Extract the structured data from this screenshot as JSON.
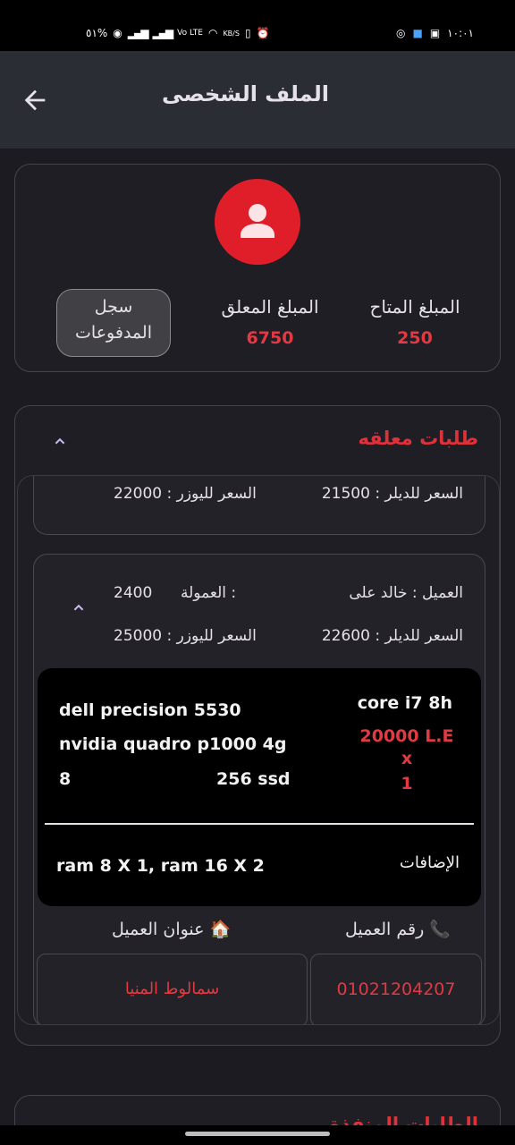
{
  "status_bar": {
    "time": "١٠:٠١",
    "battery": "٥١%",
    "speed": "KB/S",
    "volte": "Vo LTE"
  },
  "app_bar": {
    "title": "الملف الشخصى",
    "back_icon": "arrow-left-icon"
  },
  "profile": {
    "avatar_icon": "person-icon",
    "available_label": "المبلغ المتاح",
    "available_value": "250",
    "pending_label": "المبلغ المعلق",
    "pending_value": "6750",
    "payments_button_line1": "سجل",
    "payments_button_line2": "المدفوعات"
  },
  "pending_orders": {
    "title": "طلبات معلقه",
    "chevron_icon": "chevron-up-icon",
    "orders": [
      {
        "dealer_price": "السعر للديلر : 21500",
        "user_price": "السعر لليوزر : 22000"
      },
      {
        "customer": "العميل : خالد على",
        "commission_label": "العمولة :",
        "commission_value": "2400",
        "dealer_price": "السعر للديلر : 22600",
        "user_price": "السعر لليوزر : 25000",
        "details": {
          "model": "dell precision 5530",
          "gpu": "nvidia quadro p1000 4g",
          "ram": "8",
          "storage": "256 ssd",
          "cpu": "core i7 8h",
          "price": "20000 L.E",
          "x": "x",
          "qty": "1",
          "additions_label": "الإضافات",
          "additions_value": "ram 8 X 1, ram 16 X 2"
        },
        "phone_label": "رقم العميل",
        "phone_icon": "phone-icon",
        "address_label": "عنوان العميل",
        "address_icon": "house-icon",
        "phone_value": "01021204207",
        "address_value": "سمالوط المنيا"
      }
    ]
  },
  "next_section_title": "الطلبات المنفذة"
}
